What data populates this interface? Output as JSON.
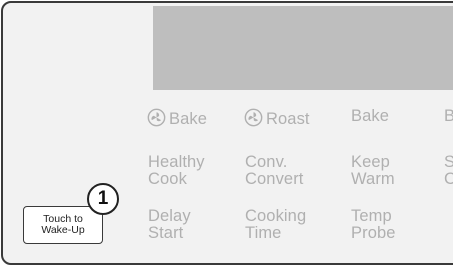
{
  "display": {
    "color": "#bebebe"
  },
  "row1": {
    "conv_bake": "Bake",
    "conv_roast": "Roast",
    "bake": "Bake",
    "cut_off": "B"
  },
  "row2": {
    "healthy_cook": [
      "Healthy",
      "Cook"
    ],
    "conv_convert": [
      "Conv.",
      "Convert"
    ],
    "keep_warm": [
      "Keep",
      "Warm"
    ],
    "cut_off": [
      "S",
      "C"
    ]
  },
  "row3": {
    "delay_start": [
      "Delay",
      "Start"
    ],
    "cooking_time": [
      "Cooking",
      "Time"
    ],
    "temp_probe": [
      "Temp",
      "Probe"
    ]
  },
  "wake_button": {
    "lines": [
      "Touch to",
      "Wake-Up"
    ]
  },
  "callout": {
    "number": "1"
  },
  "icons": {
    "convection": "convection-fan-icon"
  },
  "colors": {
    "panel": "#f2f2f2",
    "border": "#3a3a3a",
    "label": "#b0b0b0"
  }
}
